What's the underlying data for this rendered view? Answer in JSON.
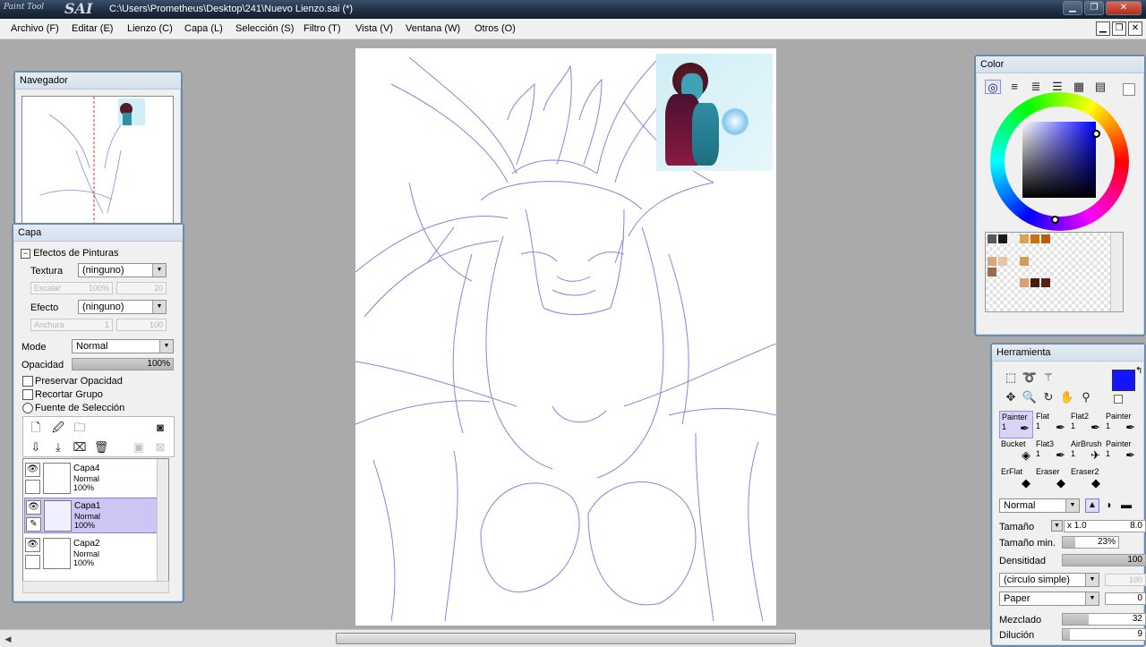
{
  "app": {
    "logo_small": "Paint Tool",
    "logo_big": "SAI",
    "window_title": "C:\\Users\\Prometheus\\Desktop\\241\\Nuevo Lienzo.sai (*)"
  },
  "menu": [
    "Archivo (F)",
    "Editar (E)",
    "Lienzo (C)",
    "Capa (L)",
    "Selección (S)",
    "Filtro (T)",
    "Vista (V)",
    "Ventana (W)",
    "Otros (O)"
  ],
  "navigator": {
    "title": "Navegador"
  },
  "layer_panel": {
    "title": "Capa",
    "effects_header": "Efectos de Pinturas",
    "texture_label": "Textura",
    "texture_value": "(ninguno)",
    "scale_label": "Escalar",
    "scale_value": "100%",
    "scale_value2": "20",
    "effect_label": "Efecto",
    "effect_value": "(ninguno)",
    "width_label": "Anchura",
    "width_value": "1",
    "width_value2": "100",
    "mode_label": "Mode",
    "mode_value": "Normal",
    "opacity_label": "Opacidad",
    "opacity_value": "100%",
    "opacity_fraction": 1.0,
    "preserve_opacity": "Preservar Opacidad",
    "clip_group": "Recortar Grupo",
    "selection_source": "Fuente de Selección",
    "layers": [
      {
        "name": "Capa4",
        "mode": "Normal",
        "opacity": "100%",
        "selected": false
      },
      {
        "name": "Capa1",
        "mode": "Normal",
        "opacity": "100%",
        "selected": true
      },
      {
        "name": "Capa2",
        "mode": "Normal",
        "opacity": "100%",
        "selected": false
      }
    ]
  },
  "color_panel": {
    "title": "Color",
    "current_color": "#1414ff"
  },
  "tool_panel": {
    "title": "Herramienta",
    "tools": [
      {
        "name": "Painter",
        "num": "1",
        "icon": "brush-icon"
      },
      {
        "name": "Flat",
        "num": "1",
        "icon": "brush-icon"
      },
      {
        "name": "Flat2",
        "num": "1",
        "icon": "brush-icon"
      },
      {
        "name": "Painter",
        "num": "1",
        "icon": "brush-icon"
      },
      {
        "name": "Bucket",
        "num": "",
        "icon": "bucket-icon"
      },
      {
        "name": "Flat3",
        "num": "1",
        "icon": "brush-icon"
      },
      {
        "name": "AirBrush",
        "num": "1",
        "icon": "airbrush-icon"
      },
      {
        "name": "Painter",
        "num": "1",
        "icon": "brush-icon"
      },
      {
        "name": "ErFlat",
        "num": "",
        "icon": "eraser-icon"
      },
      {
        "name": "Eraser",
        "num": "",
        "icon": "eraser-icon"
      },
      {
        "name": "Eraser2",
        "num": "",
        "icon": "eraser-icon"
      }
    ],
    "blend_mode": "Normal",
    "size_label": "Tamaño",
    "size_mult": "x 1.0",
    "size_value": "8.0",
    "min_size_label": "Tamaño min.",
    "min_size_value": "23%",
    "min_size_fraction": 0.23,
    "density_label": "Densitidad",
    "density_value": "100",
    "shape_value": "(circulo simple)",
    "shape_value2": "100",
    "texture_value": "Paper",
    "texture_value2": "0",
    "blend_label": "Mezclado",
    "blend_value": "32",
    "blend_fraction": 0.32,
    "dilution_label": "Dilución",
    "dilution_value": "9"
  }
}
